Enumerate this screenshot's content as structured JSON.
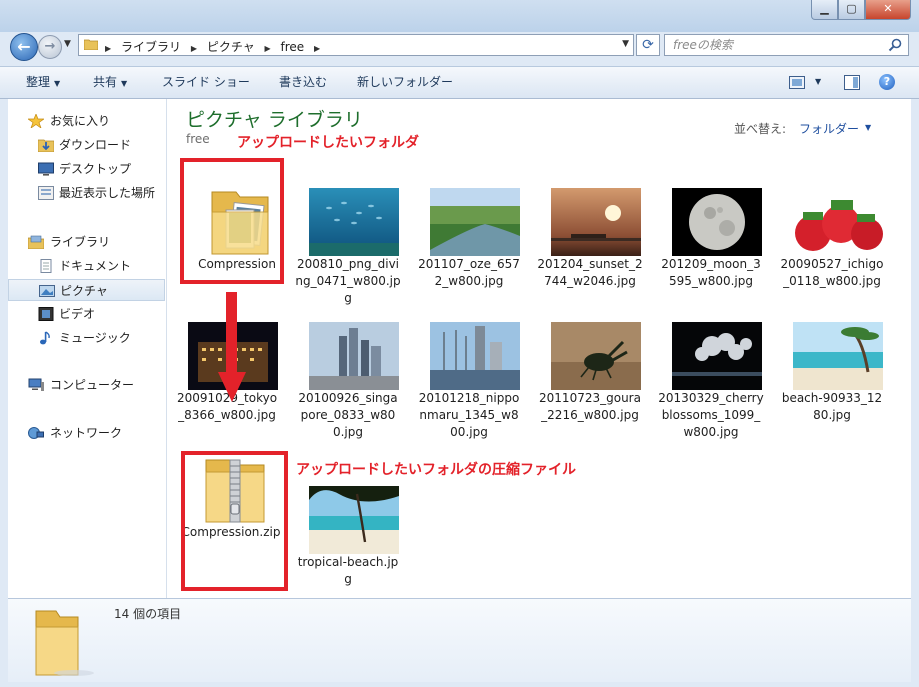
{
  "nav": {
    "crumbs": [
      "ライブラリ",
      "ピクチャ",
      "free"
    ],
    "search_placeholder": "freeの検索"
  },
  "toolbar": {
    "organize": "整理",
    "share": "共有",
    "slideshow": "スライド ショー",
    "burn": "書き込む",
    "new_folder": "新しいフォルダー"
  },
  "sidebar": {
    "favorites": "お気に入り",
    "favorites_items": [
      "ダウンロード",
      "デスクトップ",
      "最近表示した場所"
    ],
    "libraries": "ライブラリ",
    "libraries_items": [
      "ドキュメント",
      "ピクチャ",
      "ビデオ",
      "ミュージック"
    ],
    "computer": "コンピューター",
    "network": "ネットワーク"
  },
  "library": {
    "title": "ピクチャ ライブラリ",
    "subtitle": "free",
    "sort_label": "並べ替え:",
    "sort_value": "フォルダー"
  },
  "files": [
    "Compression",
    "200810_png_diving_0471_w800.jpg",
    "201107_oze_6572_w800.jpg",
    "201204_sunset_2744_w2046.jpg",
    "201209_moon_3595_w800.jpg",
    "20090527_ichigo_0118_w800.jpg",
    "20091029_tokyo_8366_w800.jpg",
    "20100926_singapore_0833_w800.jpg",
    "20101218_nipponmaru_1345_w800.jpg",
    "20110723_goura_2216_w800.jpg",
    "20130329_cherryblossoms_1099_w800.jpg",
    "beach-90933_1280.jpg",
    "Compression.zip",
    "tropical-beach.jpg"
  ],
  "annotations": {
    "folder_label": "アップロードしたいフォルダ",
    "zip_label": "アップロードしたいフォルダの圧縮ファイル",
    "color": "#e3222a"
  },
  "details": {
    "count": "14 個の項目"
  },
  "colors": {
    "library_title": "#1e6e2c",
    "link": "#1f4f9f",
    "selection": "#dce8f4"
  }
}
